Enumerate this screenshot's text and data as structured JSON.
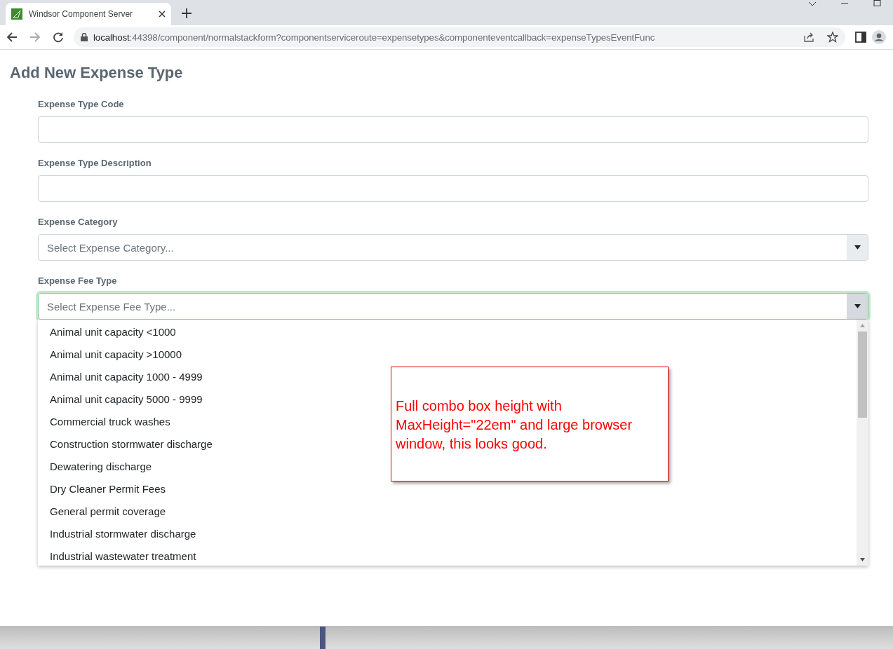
{
  "browser": {
    "tab_title": "Windsor Component Server",
    "url_host": "localhost",
    "url_rest": ":44398/component/normalstackform?componentserviceroute=expensetypes&componenteventcallback=expenseTypesEventFunc"
  },
  "page": {
    "title": "Add New Expense Type",
    "fields": [
      {
        "kind": "text",
        "label": "Expense Type Code"
      },
      {
        "kind": "text",
        "label": "Expense Type Description"
      },
      {
        "kind": "select",
        "label": "Expense Category",
        "placeholder": "Select Expense Category...",
        "focused": false
      },
      {
        "kind": "select",
        "label": "Expense Fee Type",
        "placeholder": "Select Expense Fee Type...",
        "focused": true,
        "expanded": true
      }
    ],
    "options": [
      "Animal unit capacity <1000",
      "Animal unit capacity >10000",
      "Animal unit capacity 1000 - 4999",
      "Animal unit capacity 5000 - 9999",
      "Commercial truck washes",
      "Construction stormwater discharge",
      "Dewatering discharge",
      "Dry Cleaner Permit Fees",
      "General permit coverage",
      "Industrial stormwater discharge",
      "Industrial wastewater treatment"
    ]
  },
  "annotation": {
    "text": "Full combo box height with MaxHeight=\"22em\" and large browser window, this looks good."
  }
}
